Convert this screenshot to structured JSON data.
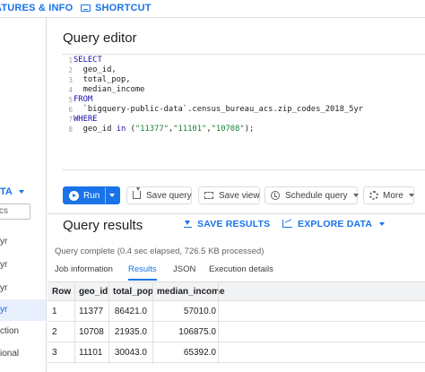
{
  "topbar": {
    "features_label": "ATURES & INFO",
    "shortcut_label": "SHORTCUT"
  },
  "sidebar": {
    "data_label": "TA",
    "search_placeholder": "cs",
    "items": [
      "yr",
      "yr",
      "yr",
      "yr",
      "ction",
      "ional"
    ],
    "selected_index": 3
  },
  "editor": {
    "title": "Query editor",
    "line_numbers": [
      "1",
      "2",
      "3",
      "4",
      "5",
      "6",
      "7",
      "8"
    ],
    "lines": {
      "l1": "SELECT",
      "l2": "  geo_id,",
      "l3": "  total_pop,",
      "l4": "  median_income",
      "l5": "FROM",
      "l6": "  `bigquery-public-data`.census_bureau_acs.zip_codes_2018_5yr",
      "l7": "WHERE",
      "l8_pre": "  geo_id ",
      "l8_kw": "in",
      "l8_open": " (",
      "l8_s1": "\"11377\"",
      "l8_c1": ",",
      "l8_s2": "\"11101\"",
      "l8_c2": ",",
      "l8_s3": "\"10708\"",
      "l8_close": ");"
    }
  },
  "toolbar": {
    "run_label": "Run",
    "save_query_label": "Save query",
    "save_view_label": "Save view",
    "schedule_label": "Schedule query",
    "more_label": "More"
  },
  "results": {
    "title": "Query results",
    "save_results_label": "SAVE RESULTS",
    "explore_label": "EXPLORE DATA",
    "status": "Query complete (0.4 sec elapsed, 726.5 KB processed)",
    "tabs": [
      "Job information",
      "Results",
      "JSON",
      "Execution details"
    ],
    "active_tab": "Results",
    "columns": [
      "Row",
      "geo_id",
      "total_pop",
      "median_income"
    ],
    "rows": [
      {
        "row": "1",
        "geo_id": "11377",
        "total_pop": "86421.0",
        "median_income": "57010.0"
      },
      {
        "row": "2",
        "geo_id": "10708",
        "total_pop": "21935.0",
        "median_income": "106875.0"
      },
      {
        "row": "3",
        "geo_id": "11101",
        "total_pop": "30043.0",
        "median_income": "65392.0"
      }
    ]
  },
  "colors": {
    "accent": "#1a73e8",
    "selected_bg": "#e8f0fe",
    "header_bg": "#f1f3f4"
  }
}
